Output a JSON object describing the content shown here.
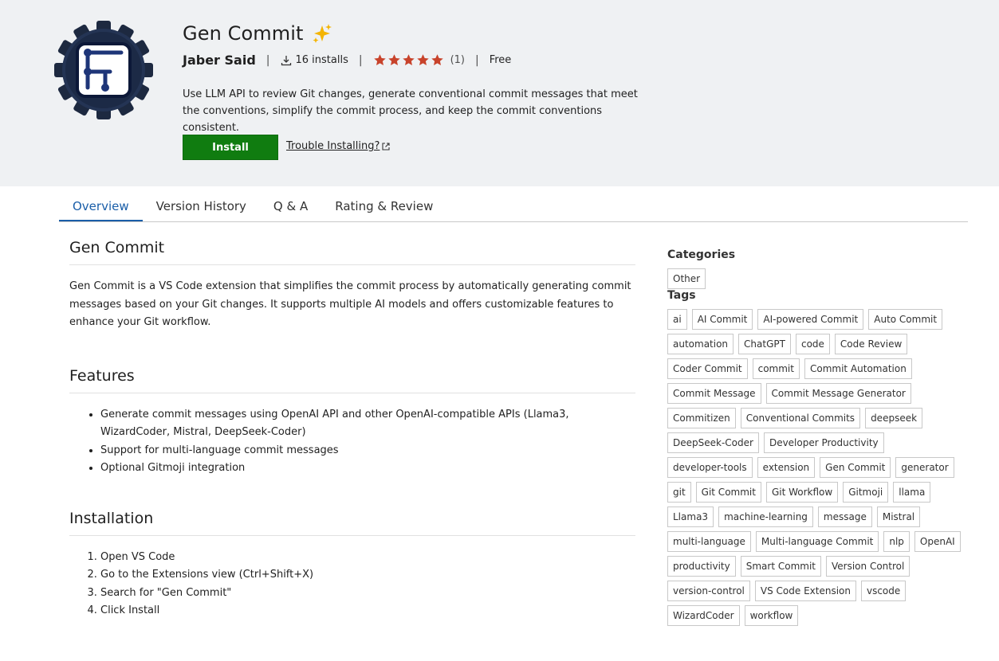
{
  "extension": {
    "name": "Gen Commit",
    "publisher": "Jaber Said",
    "installs": "16 installs",
    "rating_count": "(1)",
    "price": "Free",
    "stars": 5,
    "description": "Use LLM API to review Git changes, generate conventional commit messages that meet the conventions, simplify the commit process, and keep the commit conventions consistent.",
    "install_label": "Install",
    "trouble_label": "Trouble Installing?"
  },
  "tabs": [
    {
      "label": "Overview",
      "active": true
    },
    {
      "label": "Version History",
      "active": false
    },
    {
      "label": "Q & A",
      "active": false
    },
    {
      "label": "Rating & Review",
      "active": false
    }
  ],
  "overview": {
    "heading": "Gen Commit",
    "intro": "Gen Commit is a VS Code extension that simplifies the commit process by automatically generating commit messages based on your Git changes. It supports multiple AI models and offers customizable features to enhance your Git workflow.",
    "features_heading": "Features",
    "features": [
      "Generate commit messages using OpenAI API and other OpenAI-compatible APIs (Llama3, WizardCoder, Mistral, DeepSeek-Coder)",
      "Support for multi-language commit messages",
      "Optional Gitmoji integration"
    ],
    "installation_heading": "Installation",
    "installation_steps": [
      "Open VS Code",
      "Go to the Extensions view (Ctrl+Shift+X)",
      "Search for \"Gen Commit\"",
      "Click Install"
    ]
  },
  "sidebar": {
    "categories_heading": "Categories",
    "categories": [
      "Other"
    ],
    "tags_heading": "Tags",
    "tags": [
      "ai",
      "AI Commit",
      "AI-powered Commit",
      "Auto Commit",
      "automation",
      "ChatGPT",
      "code",
      "Code Review",
      "Coder Commit",
      "commit",
      "Commit Automation",
      "Commit Message",
      "Commit Message Generator",
      "Commitizen",
      "Conventional Commits",
      "deepseek",
      "DeepSeek-Coder",
      "Developer Productivity",
      "developer-tools",
      "extension",
      "Gen Commit",
      "generator",
      "git",
      "Git Commit",
      "Git Workflow",
      "Gitmoji",
      "llama",
      "Llama3",
      "machine-learning",
      "message",
      "Mistral",
      "multi-language",
      "Multi-language Commit",
      "nlp",
      "OpenAI",
      "productivity",
      "Smart Commit",
      "Version Control",
      "version-control",
      "VS Code Extension",
      "vscode",
      "WizardCoder",
      "workflow"
    ]
  },
  "colors": {
    "header_bg": "#eff1f3",
    "install_green": "#107c10",
    "star_color": "#c8432b",
    "tab_active": "#1a5ea8"
  },
  "icons": {
    "logo": "gear-logo-icon",
    "sparkle": "sparkles-icon",
    "download": "download-icon",
    "star": "star-icon",
    "external": "external-link-icon"
  }
}
